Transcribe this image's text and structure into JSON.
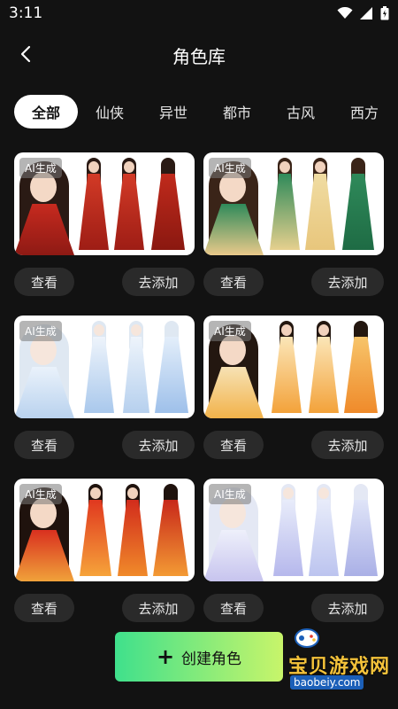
{
  "status": {
    "time": "3:11"
  },
  "header": {
    "title": "角色库"
  },
  "tabs": [
    {
      "label": "全部",
      "active": true
    },
    {
      "label": "仙侠",
      "active": false
    },
    {
      "label": "异世",
      "active": false
    },
    {
      "label": "都市",
      "active": false
    },
    {
      "label": "古风",
      "active": false
    },
    {
      "label": "西方",
      "active": false
    }
  ],
  "cards": [
    {
      "badge": "AI生成",
      "view": "查看",
      "add": "去添加",
      "theme": "red-gold"
    },
    {
      "badge": "AI生成",
      "view": "查看",
      "add": "去添加",
      "theme": "green-gold"
    },
    {
      "badge": "AI生成",
      "view": "查看",
      "add": "去添加",
      "theme": "white-blue"
    },
    {
      "badge": "AI生成",
      "view": "查看",
      "add": "去添加",
      "theme": "orange-gold"
    },
    {
      "badge": "AI生成",
      "view": "查看",
      "add": "去添加",
      "theme": "red-flame"
    },
    {
      "badge": "AI生成",
      "view": "查看",
      "add": "去添加",
      "theme": "lavender-blue"
    }
  ],
  "create_button": {
    "label": "创建角色"
  },
  "watermark": {
    "text": "宝贝游戏网",
    "url": "baobeiy.com"
  },
  "colors": {
    "background": "#121212",
    "button": "#2a2a2a",
    "create_gradient_start": "#3fe08c",
    "create_gradient_end": "#c8f56a"
  }
}
